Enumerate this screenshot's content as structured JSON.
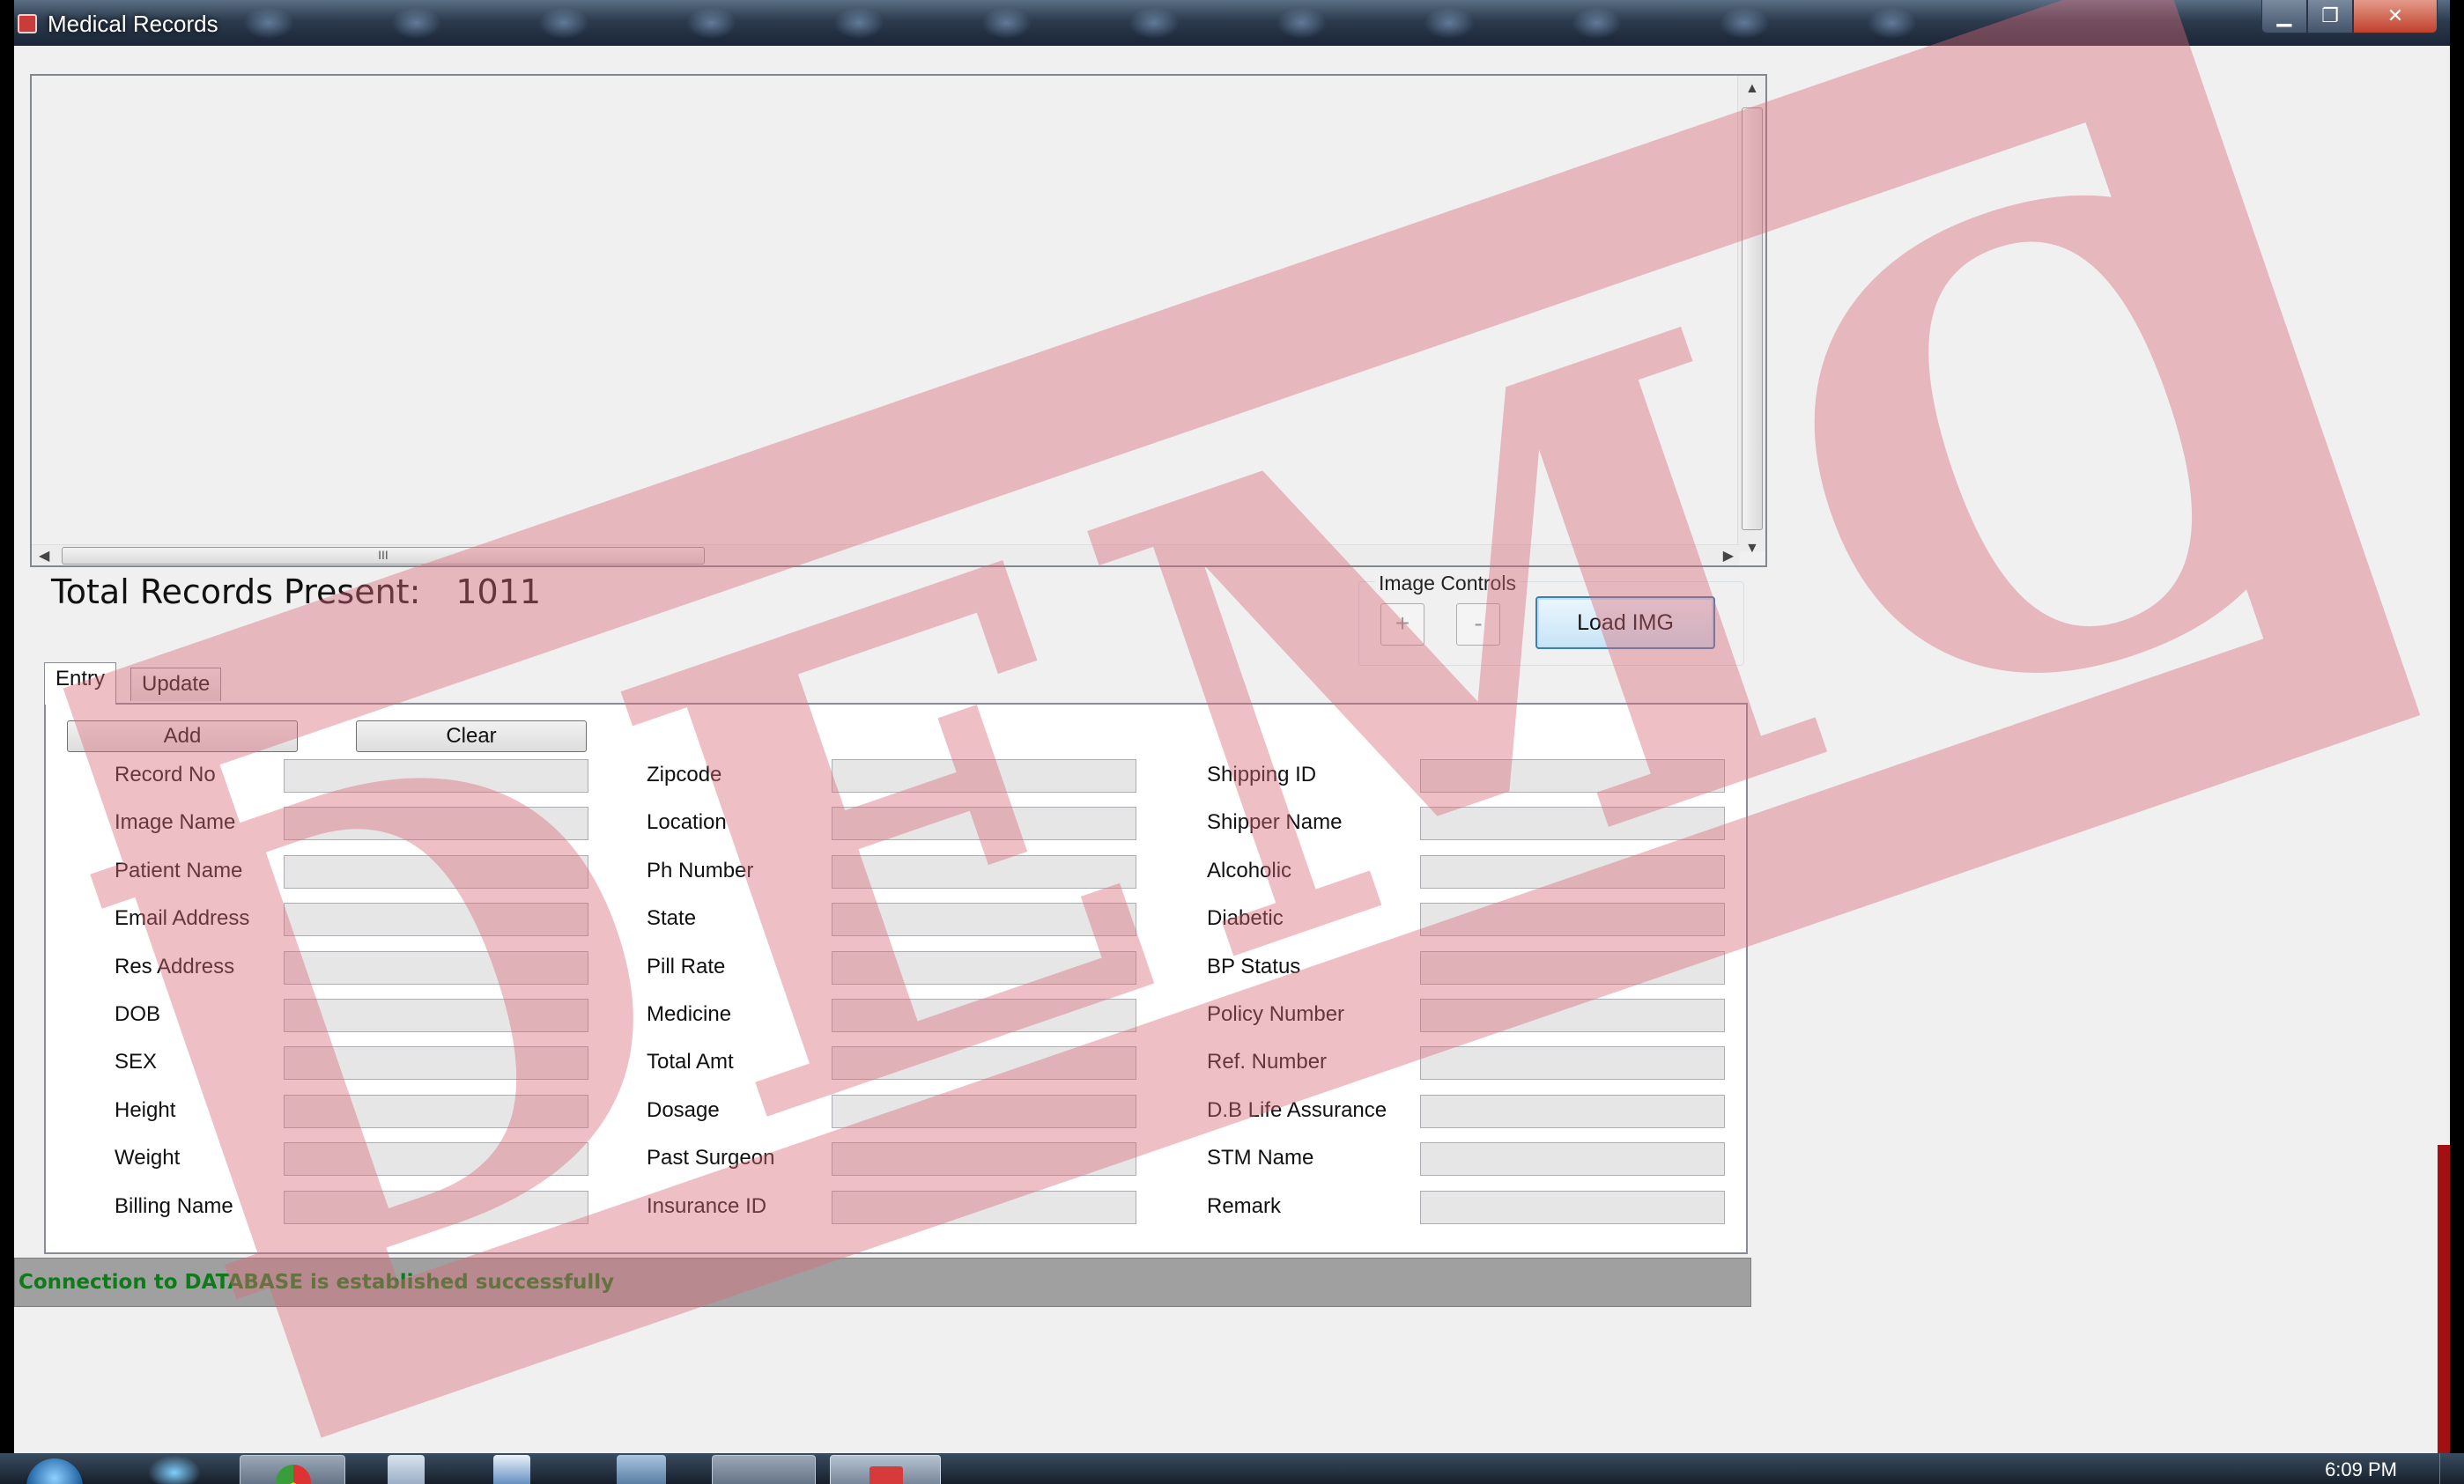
{
  "window": {
    "title": "Medical Records",
    "controls": {
      "minimize": "▁",
      "maximize": "❐",
      "close": "✕"
    }
  },
  "viewer": {
    "hscroll_grip": "III"
  },
  "records": {
    "label": "Total Records Present:",
    "count": "1011"
  },
  "image_controls": {
    "legend": "Image Controls",
    "zoom_in": "+",
    "zoom_out": "-",
    "load": "Load IMG"
  },
  "tabs": [
    "Entry",
    "Update"
  ],
  "entry": {
    "add_label": "Add",
    "clear_label": "Clear",
    "col1": [
      "Record No",
      "Image Name",
      "Patient Name",
      "Email Address",
      "Res Address",
      "DOB",
      "SEX",
      "Height",
      "Weight",
      "Billing Name"
    ],
    "col2": [
      "Zipcode",
      "Location",
      "Ph Number",
      "State",
      "Pill Rate",
      "Medicine",
      "Total Amt",
      "Dosage",
      "Past Surgeon",
      "Insurance ID"
    ],
    "col3": [
      "Shipping ID",
      "Shipper Name",
      "Alcoholic",
      "Diabetic",
      "BP Status",
      "Policy Number",
      "Ref. Number",
      "D.B Life Assurance",
      "STM Name",
      "Remark"
    ]
  },
  "status": {
    "message": "Connection to DATABASE is established successfully",
    "color": "#0f7a1a"
  },
  "watermark": {
    "text": "DEMO",
    "color": "#d96a78"
  },
  "taskbar": {
    "clock": "6:09 PM"
  }
}
